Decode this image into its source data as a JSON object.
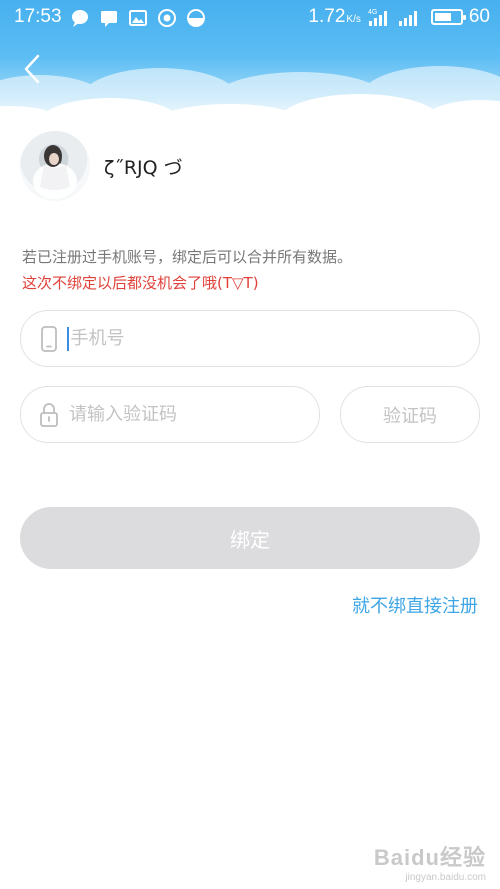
{
  "status_bar": {
    "time": "17:53",
    "net_speed": "1.72",
    "net_unit": "K/s",
    "network_type": "4G",
    "battery": "60"
  },
  "profile": {
    "name": "ζ˝RJQ づ"
  },
  "notice": {
    "line1": "若已注册过手机账号，绑定后可以合并所有数据。",
    "line2": "这次不绑定以后都没机会了哦(T▽T)"
  },
  "form": {
    "phone_placeholder": "手机号",
    "code_placeholder": "请输入验证码",
    "code_button": "验证码",
    "bind_button": "绑定",
    "skip_link": "就不绑直接注册"
  },
  "watermark": {
    "main": "Baidu经验",
    "sub": "jingyan.baidu.com"
  },
  "colors": {
    "header_blue": "#47b0ef",
    "link_blue": "#3ea5e6",
    "warning_red": "#e0413a",
    "disabled_button": "#dcdcdf"
  }
}
